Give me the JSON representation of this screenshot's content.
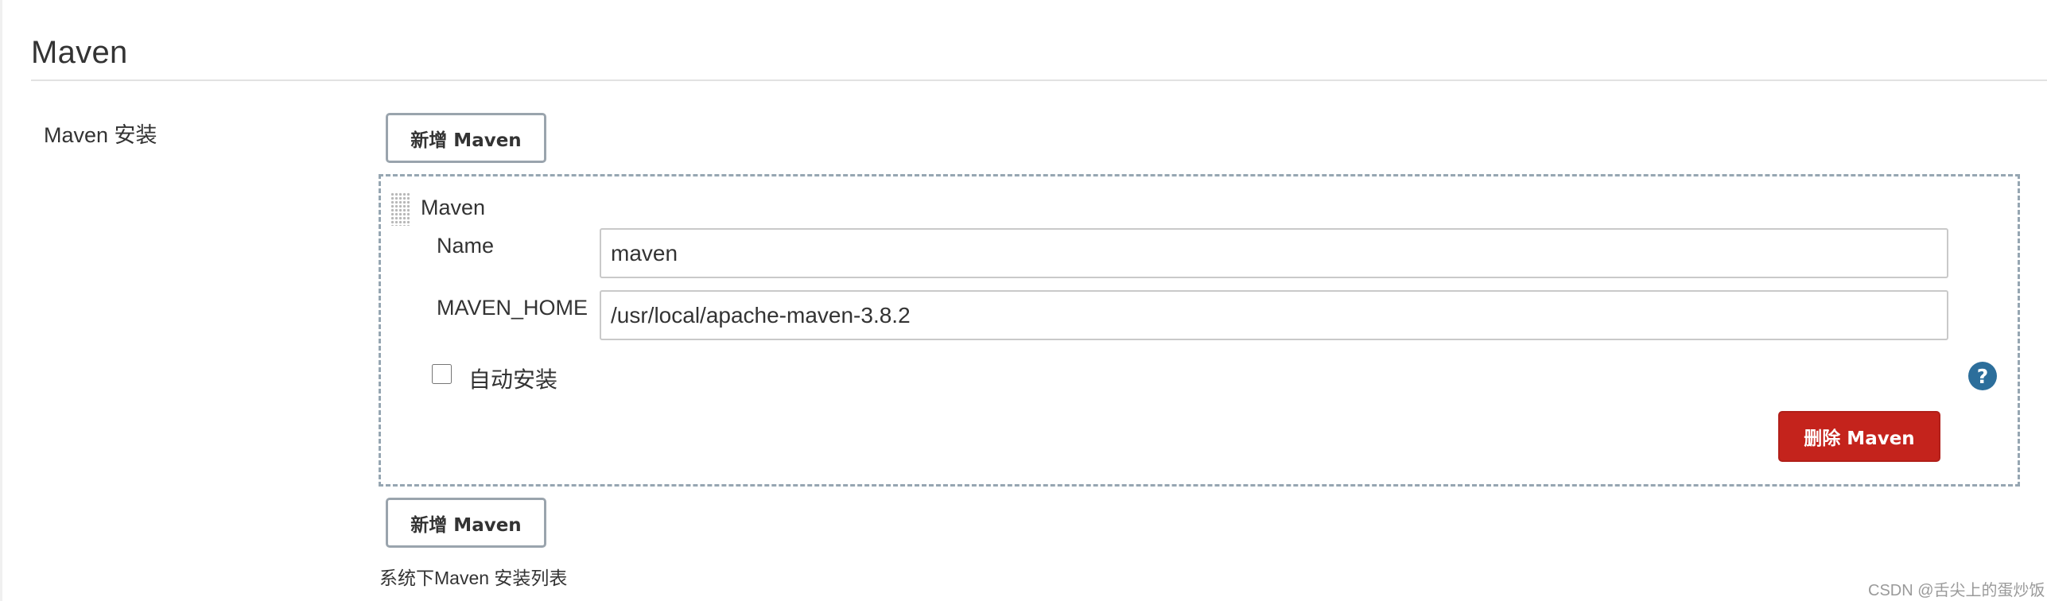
{
  "section": {
    "title": "Maven"
  },
  "setting": {
    "label": "Maven 安装",
    "add_button_label": "新增 Maven",
    "description": "系统下Maven 安装列表"
  },
  "installation": {
    "title": "Maven",
    "name_label": "Name",
    "name_value": "maven",
    "home_label": "MAVEN_HOME",
    "home_value": "/usr/local/apache-maven-3.8.2",
    "auto_install_label": "自动安装",
    "auto_install_checked": false,
    "help_glyph": "?",
    "delete_button_label": "删除 Maven"
  },
  "watermark": "CSDN @舌尖上的蛋炒饭",
  "icons": {
    "help": "help-icon",
    "drag": "drag-handle-icon"
  },
  "colors": {
    "delete_button": "#c4231c",
    "help_icon": "#2c6e9b",
    "dashed_border": "#96a6b2"
  }
}
